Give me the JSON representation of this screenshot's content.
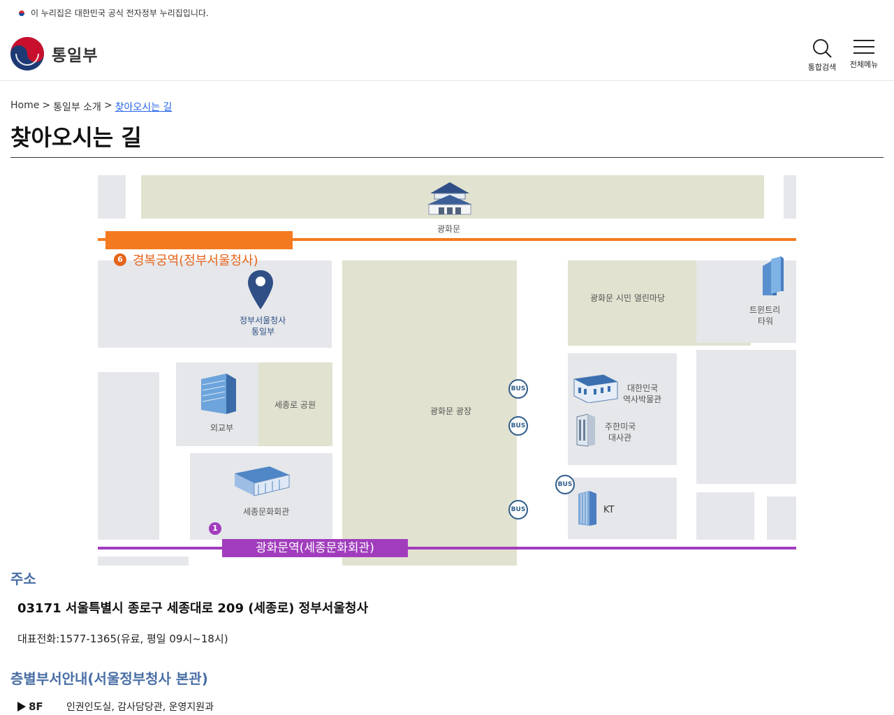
{
  "gov_banner": {
    "text": "이 누리집은 대한민국 공식 전자정부 누리집입니다.",
    "icon": "korean-flag-icon"
  },
  "header": {
    "logo_text": "통일부",
    "search_label": "통합검색",
    "menu_label": "전체메뉴"
  },
  "breadcrumb": {
    "home": "Home",
    "sep": ">",
    "parent": "통일부 소개",
    "current": "찾아오시는 길"
  },
  "page_title": "찾아오시는 길",
  "map": {
    "landmarks": {
      "gwanghwamun": "광화문",
      "station_orange_num": "6",
      "station_orange": "경복궁역(정부서울청사)",
      "pin_line1": "정부서울청사",
      "pin_line2": "통일부",
      "citizen_plaza": "광화문 시민 열린마당",
      "twin_tree_line1": "트윈트리",
      "twin_tree_line2": "타워",
      "mofa": "외교부",
      "sejongro_park": "세종로 공원",
      "gwanghwamun_square": "광화문 광장",
      "museum_line1": "대한민국",
      "museum_line2": "역사박물관",
      "us_embassy_line1": "주한미국",
      "us_embassy_line2": "대사관",
      "sejong_center": "세종문화회관",
      "kt": "KT",
      "station_purple_num": "1",
      "station_purple": "광화문역(세종문화회관)",
      "bus": "BUS"
    },
    "colors": {
      "orange_line": "#f47a20",
      "purple_line": "#a13dbd",
      "park": "#e1e2cf",
      "block": "#e5e7ea",
      "pin": "#2f4f86"
    }
  },
  "address": {
    "heading": "주소",
    "line": "03171 서울특별시 종로구 세종대로 209 (세종로) 정부서울청사",
    "tel": "대표전화:1577-1365(유료, 평일 09시~18시)"
  },
  "floors": {
    "heading": "층별부서안내(서울정부청사 본관)",
    "rows": [
      {
        "floor": "8F",
        "depts": "인권인도실, 감사담당관, 운영지원과"
      }
    ]
  }
}
